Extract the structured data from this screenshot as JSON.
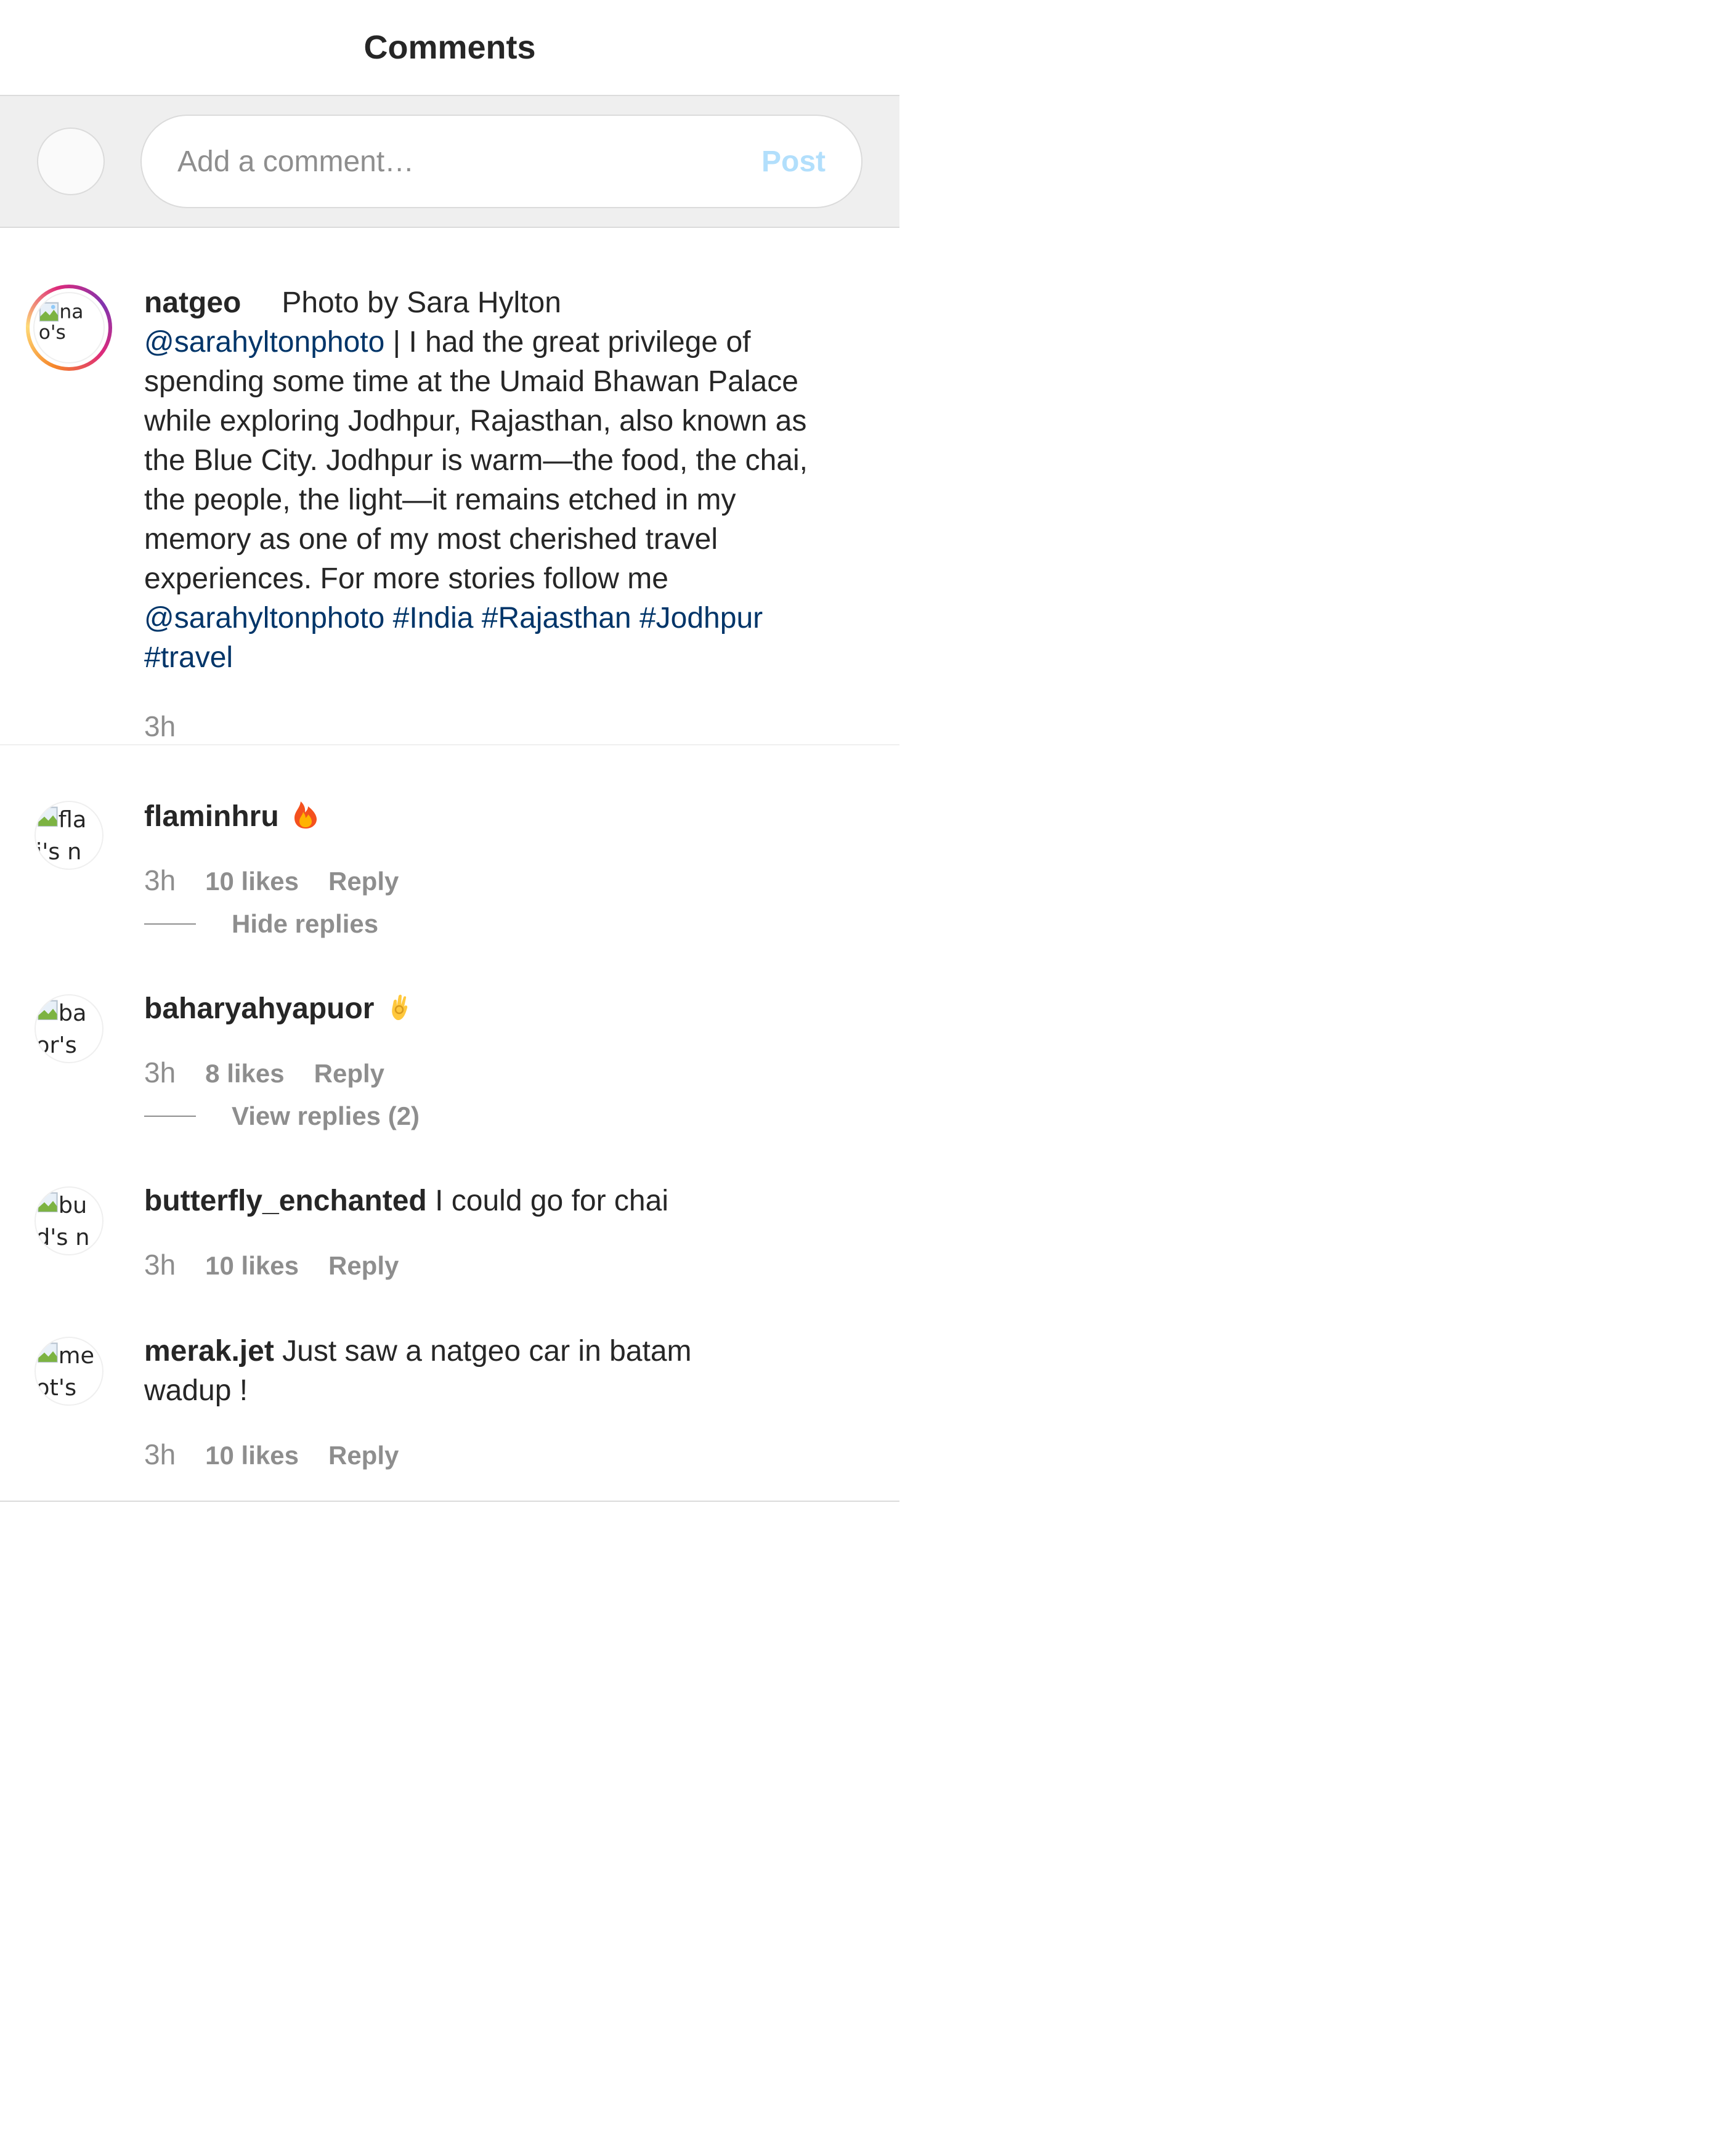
{
  "header": {
    "title": "Comments"
  },
  "composer": {
    "placeholder": "Add a comment…",
    "post_label": "Post"
  },
  "caption": {
    "username": "natgeo",
    "lead": "Photo by Sara Hylton",
    "mention_1": "@sarahyltonphoto",
    "body": " | I had the great privilege of spending some time at the Umaid Bhawan Palace while exploring Jodhpur, Rajasthan, also known as the Blue City. Jodhpur is warm—the food, the chai, the people, the light—it remains etched in my memory as one of my most cherished travel experiences. For more stories follow me ",
    "mention_2": "@sarahyltonphoto",
    "hashtags": [
      "#India",
      "#Rajasthan",
      "#Jodhpur",
      "#travel"
    ],
    "time": "3h"
  },
  "comments": [
    {
      "username": "flaminhru",
      "text": "",
      "emoji": "fire",
      "time": "3h",
      "likes": "10 likes",
      "reply_label": "Reply",
      "replies_toggle": "Hide replies"
    },
    {
      "username": "baharyahyapuor",
      "text": "",
      "emoji": "ok-hand",
      "time": "3h",
      "likes": "8 likes",
      "reply_label": "Reply",
      "replies_toggle": "View replies (2)"
    },
    {
      "username": "butterfly_enchanted",
      "text": "I could go for chai",
      "time": "3h",
      "likes": "10 likes",
      "reply_label": "Reply"
    },
    {
      "username": "merak.jet",
      "text": "Just saw a natgeo car in batam wadup !",
      "time": "3h",
      "likes": "10 likes",
      "reply_label": "Reply"
    }
  ],
  "colors": {
    "link": "#003569",
    "muted": "#8e8e8e",
    "post_disabled": "#b2dffc",
    "composer_bg": "#efefef",
    "border": "#dbdbdb"
  },
  "icons": {
    "avatar_placeholder": "broken-image-icon",
    "fire": "fire-emoji-icon",
    "ok_hand": "ok-hand-emoji-icon"
  }
}
